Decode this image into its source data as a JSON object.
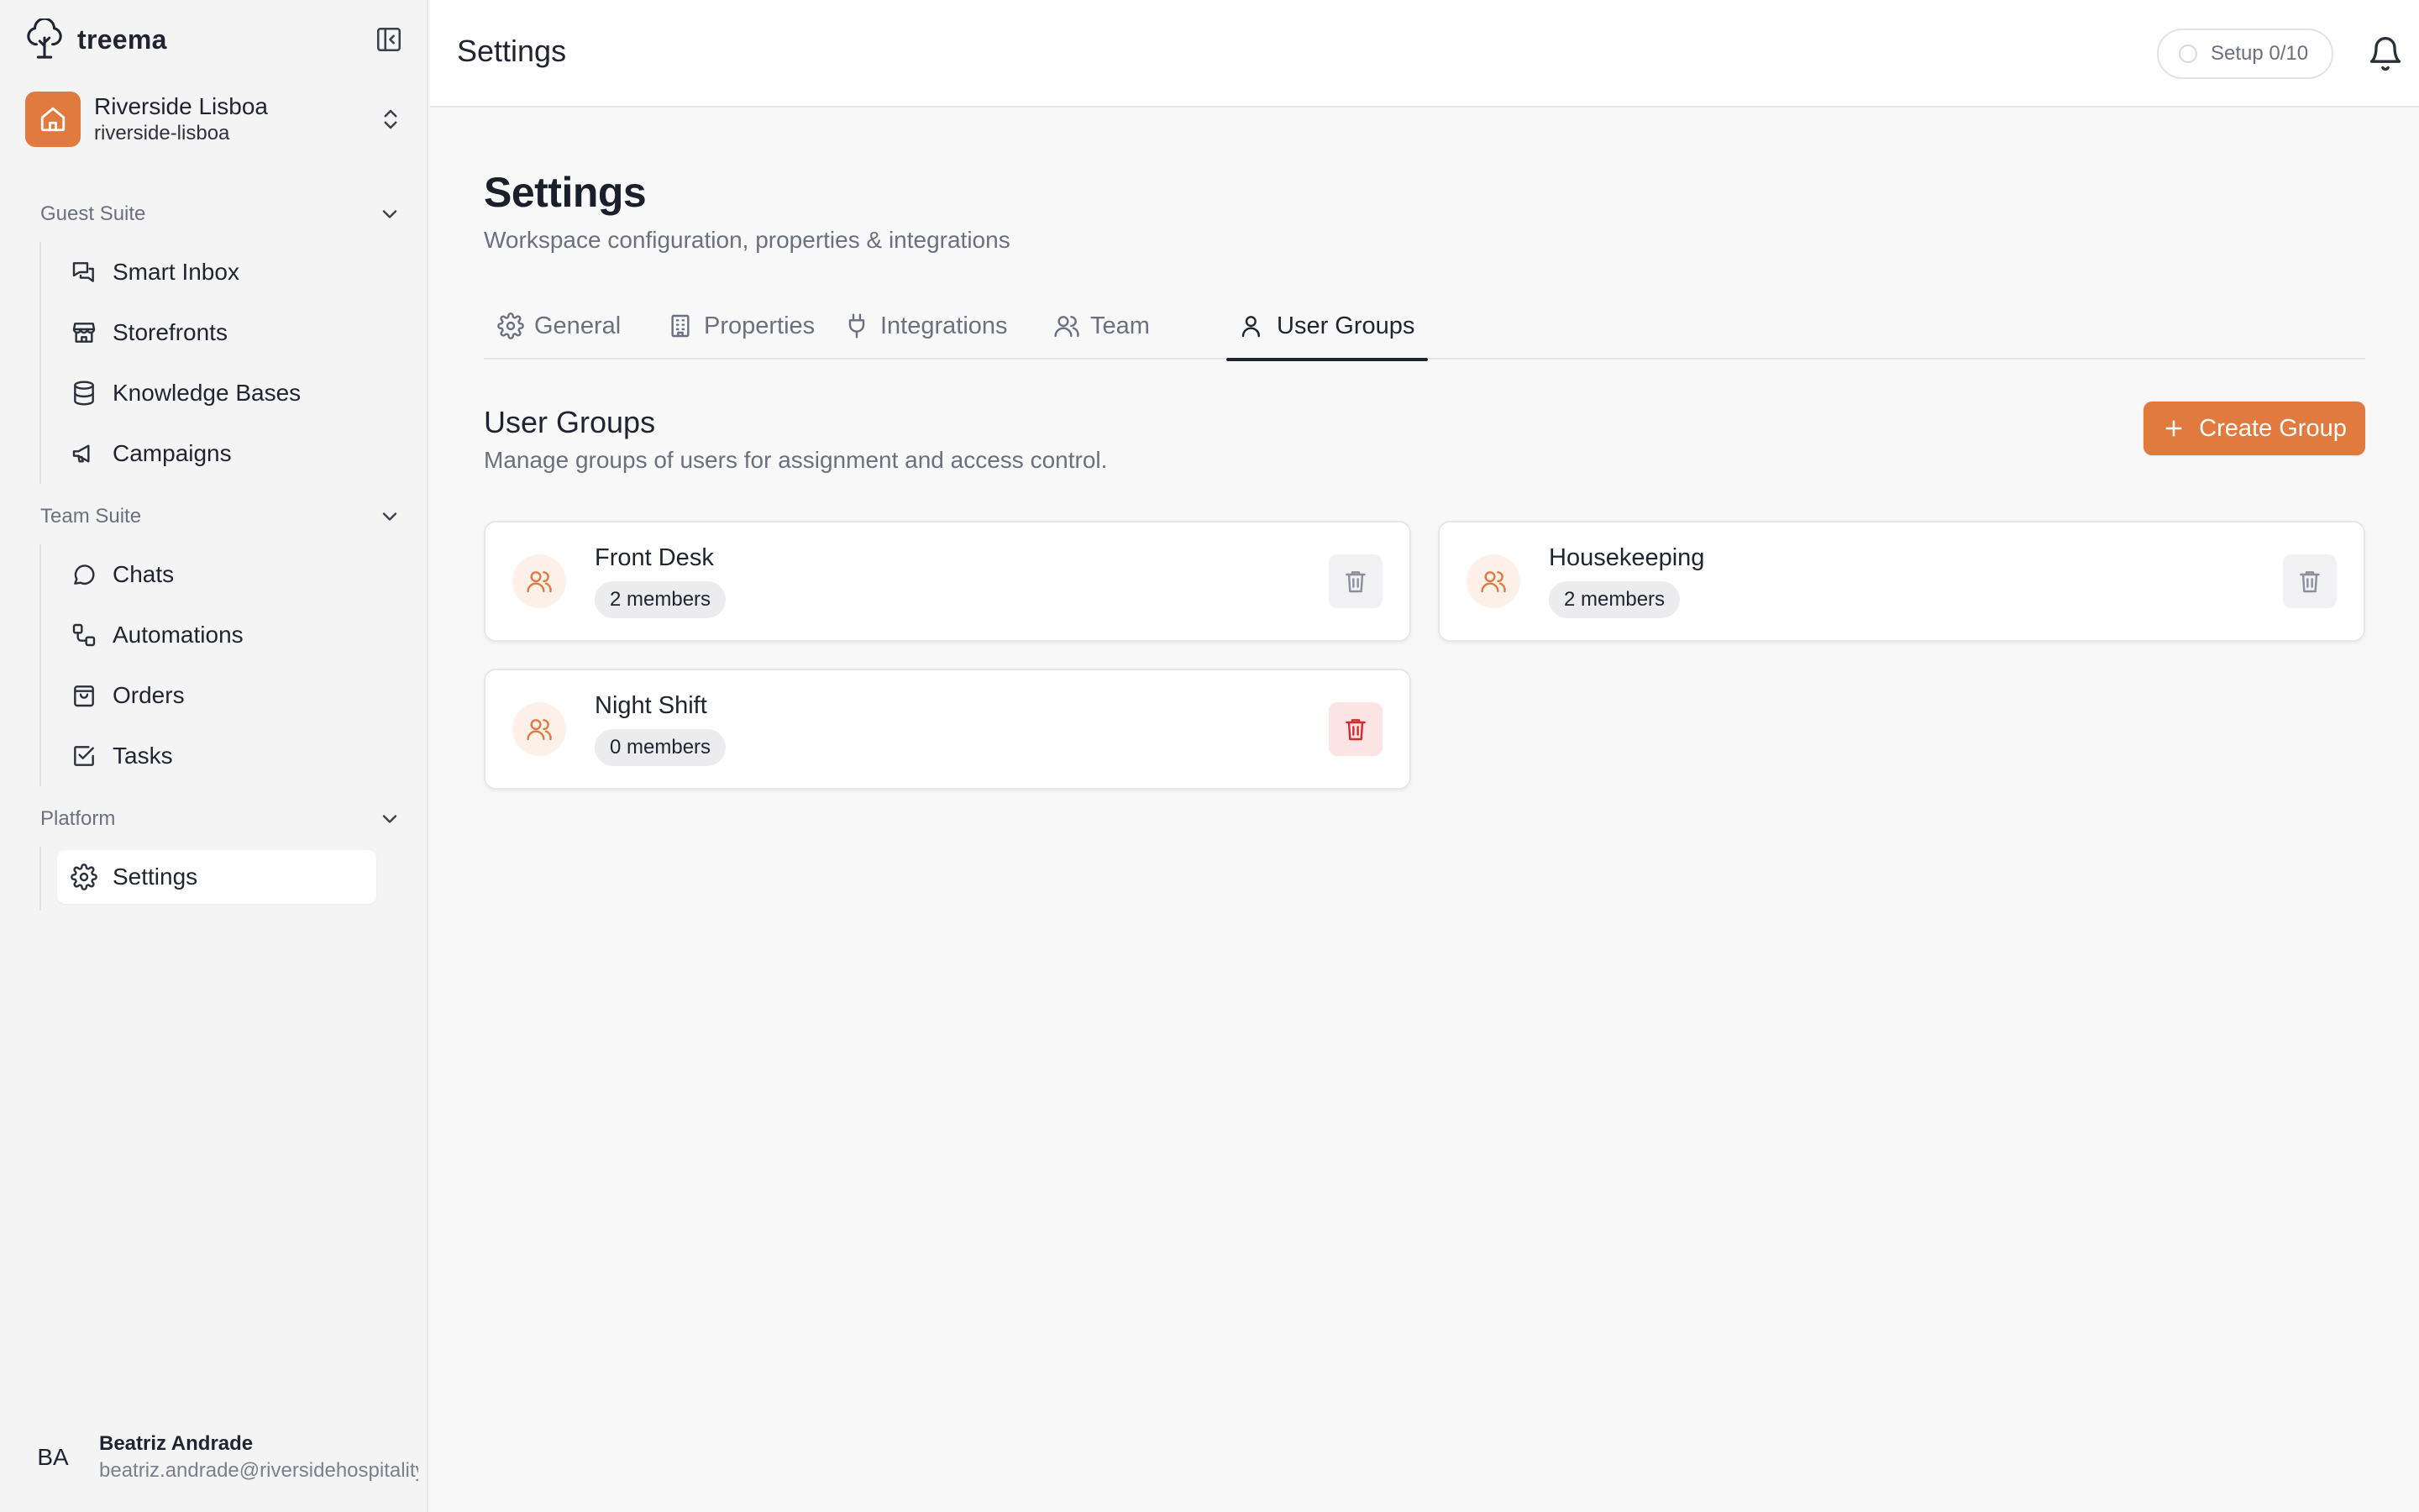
{
  "brand": {
    "name": "treema"
  },
  "workspace": {
    "name": "Riverside Lisboa",
    "slug": "riverside-lisboa"
  },
  "sidebar": {
    "sections": [
      {
        "label": "Guest Suite",
        "items": [
          {
            "label": "Smart Inbox",
            "icon": "chat-bubbles-icon"
          },
          {
            "label": "Storefronts",
            "icon": "store-icon"
          },
          {
            "label": "Knowledge Bases",
            "icon": "database-icon"
          },
          {
            "label": "Campaigns",
            "icon": "megaphone-icon"
          }
        ]
      },
      {
        "label": "Team Suite",
        "items": [
          {
            "label": "Chats",
            "icon": "chat-icon"
          },
          {
            "label": "Automations",
            "icon": "workflow-icon"
          },
          {
            "label": "Orders",
            "icon": "shopping-bag-icon"
          },
          {
            "label": "Tasks",
            "icon": "checkbox-icon"
          }
        ]
      },
      {
        "label": "Platform",
        "items": [
          {
            "label": "Settings",
            "icon": "gear-icon",
            "active": true
          }
        ]
      }
    ]
  },
  "user": {
    "initials": "BA",
    "name": "Beatriz Andrade",
    "email": "beatriz.andrade@riversidehospitality.com"
  },
  "topbar": {
    "title": "Settings",
    "setup_label": "Setup 0/10"
  },
  "page": {
    "title": "Settings",
    "subtitle": "Workspace configuration, properties & integrations"
  },
  "tabs": [
    {
      "label": "General",
      "icon": "gear-icon"
    },
    {
      "label": "Properties",
      "icon": "building-icon"
    },
    {
      "label": "Integrations",
      "icon": "plug-icon"
    },
    {
      "label": "Team",
      "icon": "users-icon"
    },
    {
      "label": "User Groups",
      "icon": "user-group-icon",
      "active": true
    }
  ],
  "groups_section": {
    "title": "User Groups",
    "subtitle": "Manage groups of users for assignment and access control.",
    "create_label": "Create Group"
  },
  "groups": [
    {
      "name": "Front Desk",
      "members": "2 members"
    },
    {
      "name": "Housekeeping",
      "members": "2 members"
    },
    {
      "name": "Night Shift",
      "members": "0 members"
    }
  ],
  "colors": {
    "accent": "#e07a3f",
    "danger": "#d12b2b"
  }
}
